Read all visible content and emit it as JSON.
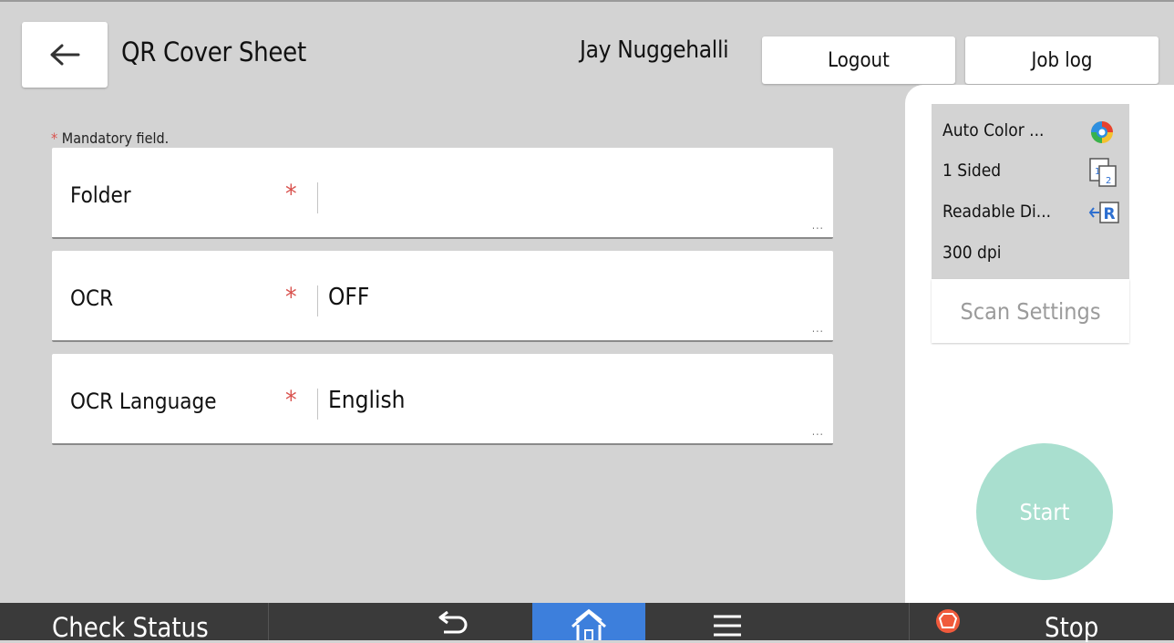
{
  "header": {
    "title": "QR Cover Sheet",
    "user_name": "Jay Nuggehalli",
    "logout_label": "Logout",
    "job_log_label": "Job log"
  },
  "form": {
    "mandatory_asterisk": "*",
    "mandatory_note": "Mandatory field.",
    "fields": [
      {
        "label": "Folder",
        "required_mark": "*",
        "value": "",
        "more": "..."
      },
      {
        "label": "OCR",
        "required_mark": "*",
        "value": "OFF",
        "more": "..."
      },
      {
        "label": "OCR Language",
        "required_mark": "*",
        "value": "English",
        "more": "..."
      }
    ]
  },
  "scan_summary": {
    "color_mode": "Auto Color ...",
    "color_mode_icon": "auto-color-icon",
    "sides": "1 Sided",
    "sides_icon": "one-sided-icon",
    "orientation": "Readable Di...",
    "orientation_icon": "readable-direction-icon",
    "resolution": "300 dpi",
    "scan_settings_label": "Scan Settings"
  },
  "start_label": "Start",
  "bottom_bar": {
    "check_status_label": "Check Status",
    "stop_label": "Stop",
    "icons": [
      "back-arrow-icon",
      "home-icon",
      "menu-icon",
      "stop-icon"
    ]
  },
  "colors": {
    "background": "#d3d3d3",
    "required_red": "#d9534f",
    "start_button": "#a9dfcf",
    "home_active": "#3d7fdc",
    "bottom_bar": "#3a3a3a"
  }
}
